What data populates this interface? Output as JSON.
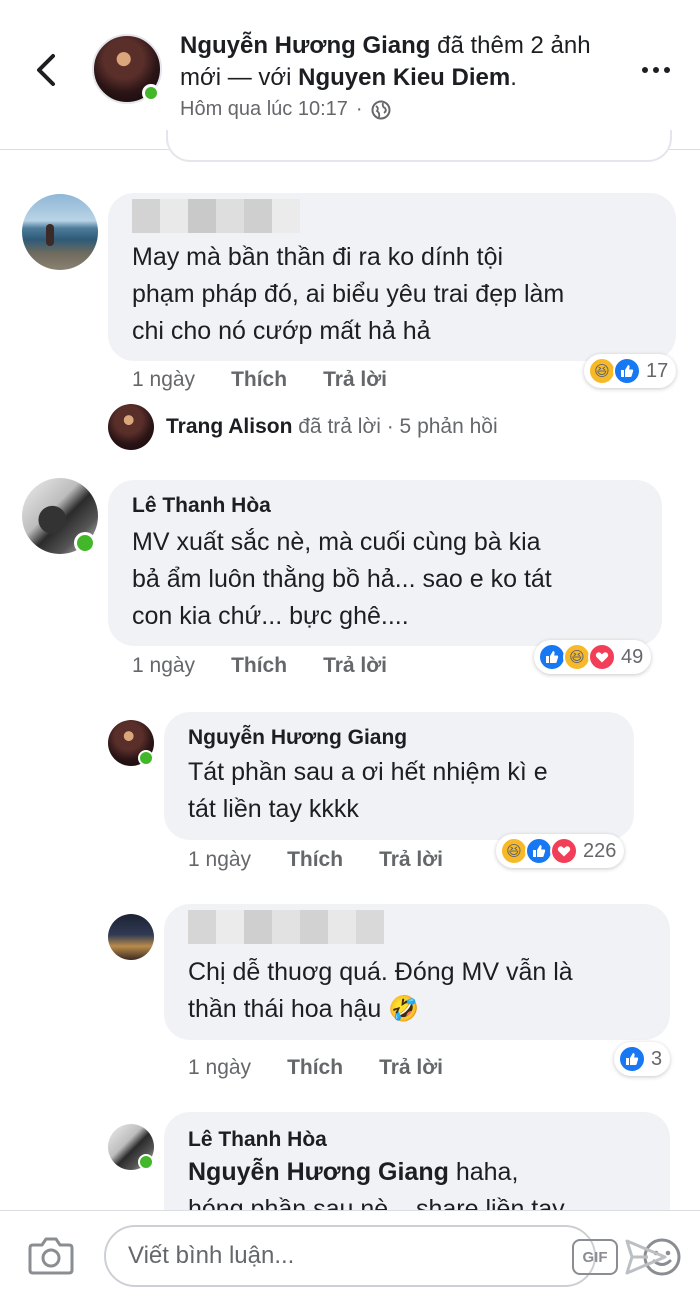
{
  "header": {
    "author": "Nguyễn Hương Giang",
    "action": " đã thêm 2 ảnh mới — với ",
    "tagged": "Nguyen Kieu Diem",
    "tagged_suffix": ".",
    "timestamp": "Hôm qua lúc 10:17",
    "separator": "·"
  },
  "comments": [
    {
      "text_lines": [
        "May mà bần thần đi ra ko dính tội",
        "phạm pháp đó, ai biểu yêu trai đẹp làm",
        "chi cho nó cướp mất hả hả"
      ],
      "time": "1 ngày",
      "like": "Thích",
      "reply": "Trả lời",
      "reaction_count": "17",
      "reactions": [
        "haha",
        "like"
      ]
    },
    {
      "name": "Lê Thanh Hòa",
      "text_lines": [
        "MV xuất sắc nè, mà cuối cùng bà kia",
        "bả ẩm luôn thằng bồ hả... sao e ko tát",
        "con kia chứ... bực ghê...."
      ],
      "time": "1 ngày",
      "like": "Thích",
      "reply": "Trả lời",
      "reaction_count": "49",
      "reactions": [
        "like",
        "haha",
        "love"
      ]
    },
    {
      "name": "Nguyễn Hương Giang",
      "text_lines": [
        "Tát phần sau a ơi hết nhiệm kì e",
        "tát liền tay kkkk"
      ],
      "time": "1 ngày",
      "like": "Thích",
      "reply": "Trả lời",
      "reaction_count": "226",
      "reactions": [
        "haha",
        "like",
        "love"
      ]
    },
    {
      "text_lines": [
        "Chị dễ thuơg quá. Đóng MV vẫn là",
        "thần thái hoa hậu 🤣"
      ],
      "time": "1 ngày",
      "like": "Thích",
      "reply": "Trả lời",
      "reaction_count": "3",
      "reactions": [
        "like"
      ]
    },
    {
      "name": "Lê Thanh Hòa",
      "mention": "Nguyễn Hương Giang",
      "text_first": " haha,",
      "text_partial": "hóng phần sau nè... share liền tay"
    }
  ],
  "reply_summary": {
    "name": "Trang Alison",
    "action": "đã trả lời",
    "count": "· 5 phản hồi"
  },
  "composer": {
    "placeholder": "Viết bình luận...",
    "gif_label": "GIF"
  },
  "colors": {
    "like": "#1877f2",
    "haha": "#f7b928",
    "love": "#f33e58",
    "online": "#42b72a"
  }
}
